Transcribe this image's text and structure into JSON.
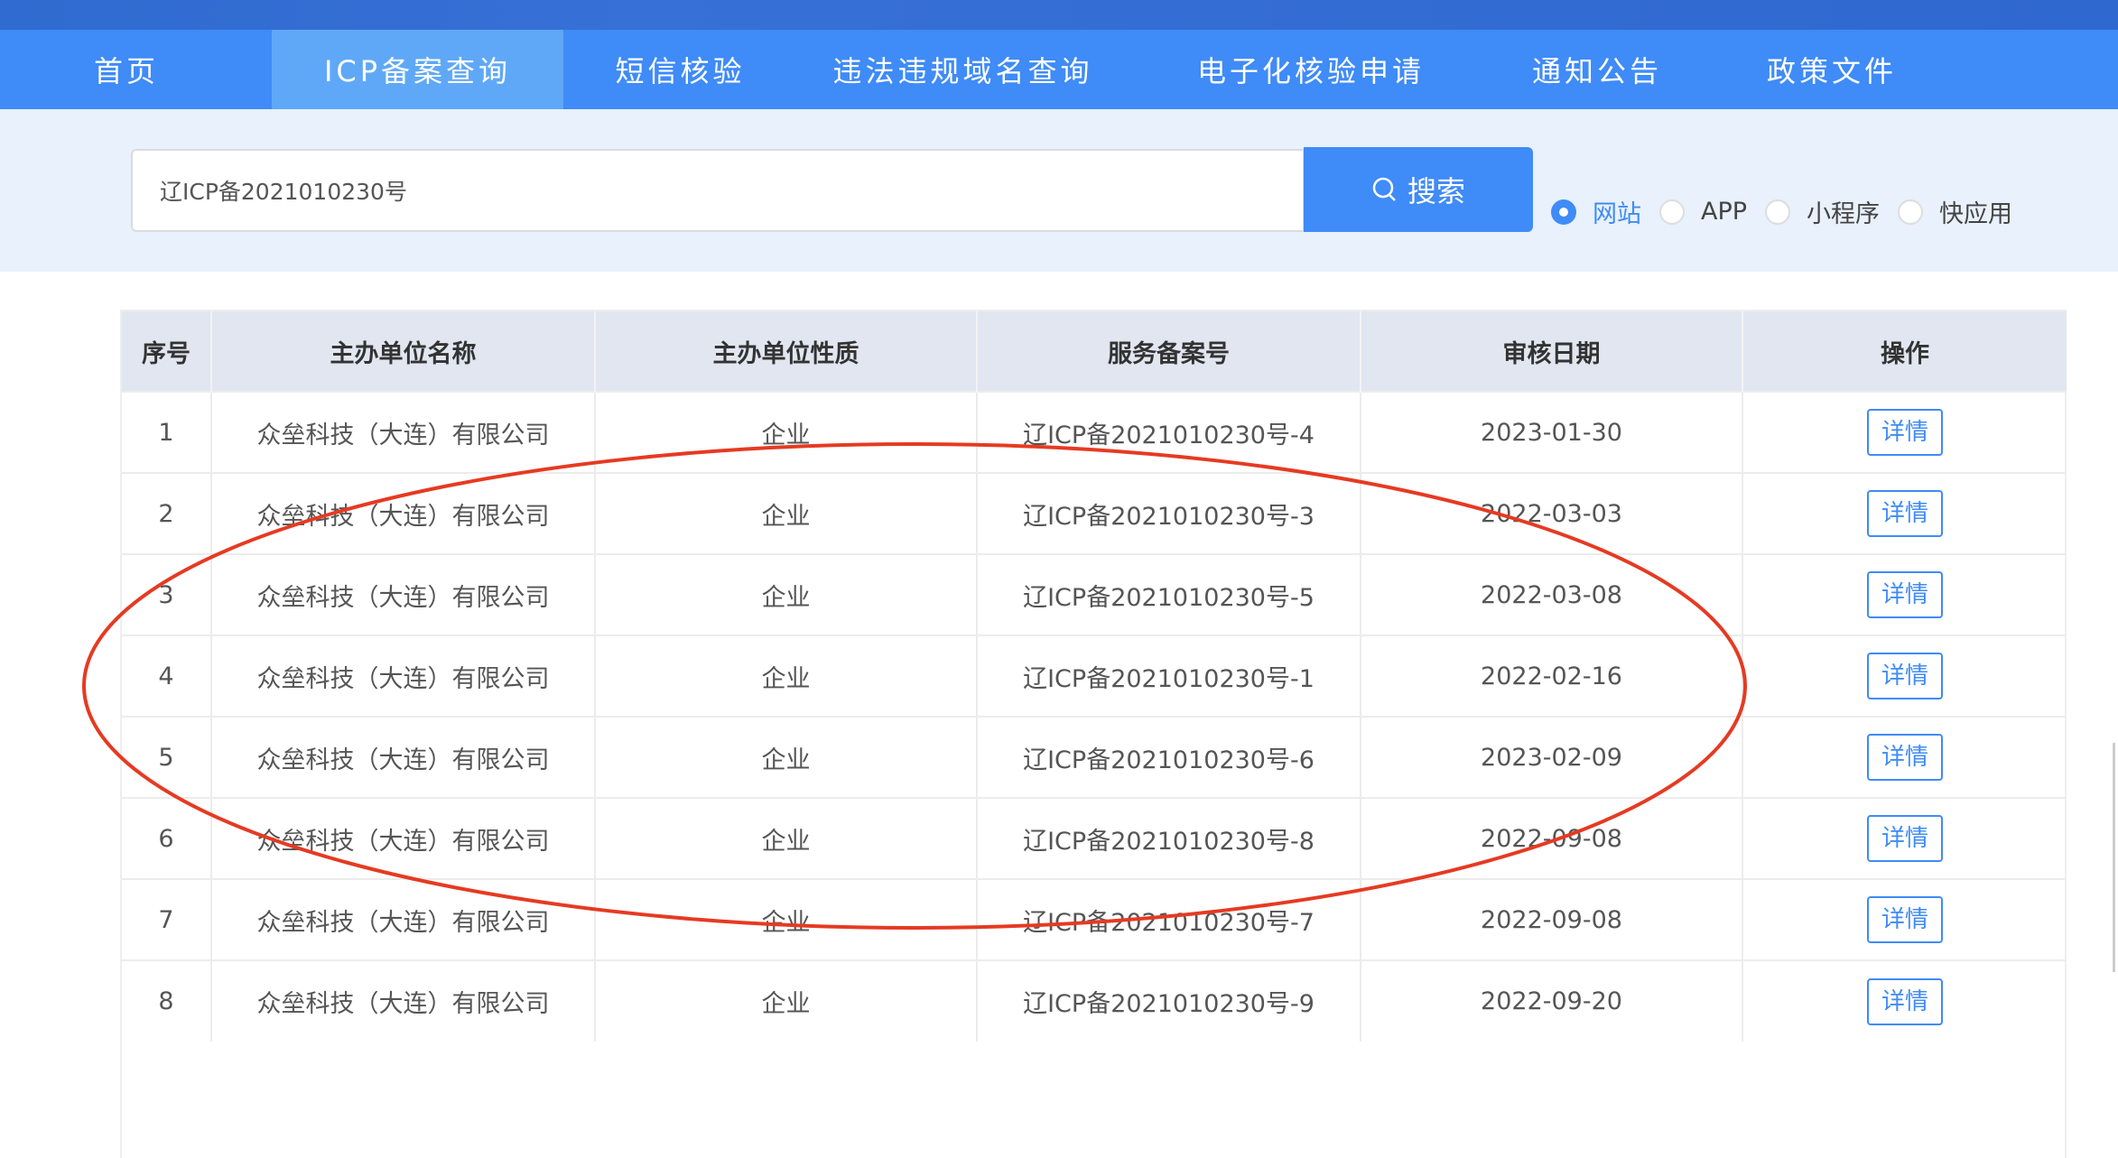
{
  "nav": {
    "tabs": [
      "首页",
      "ICP备案查询",
      "短信核验",
      "违法违规域名查询",
      "电子化核验申请",
      "通知公告",
      "政策文件"
    ],
    "active": 1
  },
  "search": {
    "value": "辽ICP备2021010230号",
    "button": "搜索"
  },
  "radios": [
    {
      "label": "网站",
      "checked": true
    },
    {
      "label": "APP",
      "checked": false
    },
    {
      "label": "小程序",
      "checked": false
    },
    {
      "label": "快应用",
      "checked": false
    }
  ],
  "table": {
    "headers": [
      "序号",
      "主办单位名称",
      "主办单位性质",
      "服务备案号",
      "审核日期",
      "操作"
    ],
    "rows": [
      [
        "1",
        "众垒科技（大连）有限公司",
        "企业",
        "辽ICP备2021010230号-4",
        "2023-01-30",
        "详情"
      ],
      [
        "2",
        "众垒科技（大连）有限公司",
        "企业",
        "辽ICP备2021010230号-3",
        "2022-03-03",
        "详情"
      ],
      [
        "3",
        "众垒科技（大连）有限公司",
        "企业",
        "辽ICP备2021010230号-5",
        "2022-03-08",
        "详情"
      ],
      [
        "4",
        "众垒科技（大连）有限公司",
        "企业",
        "辽ICP备2021010230号-1",
        "2022-02-16",
        "详情"
      ],
      [
        "5",
        "众垒科技（大连）有限公司",
        "企业",
        "辽ICP备2021010230号-6",
        "2023-02-09",
        "详情"
      ],
      [
        "6",
        "众垒科技（大连）有限公司",
        "企业",
        "辽ICP备2021010230号-8",
        "2022-09-08",
        "详情"
      ],
      [
        "7",
        "众垒科技（大连）有限公司",
        "企业",
        "辽ICP备2021010230号-7",
        "2022-09-08",
        "详情"
      ],
      [
        "8",
        "众垒科技（大连）有限公司",
        "企业",
        "辽ICP备2021010230号-9",
        "2022-09-20",
        "详情"
      ]
    ]
  },
  "colors": {
    "primary": "#3f8bf7",
    "annotation": "#e63a22"
  }
}
